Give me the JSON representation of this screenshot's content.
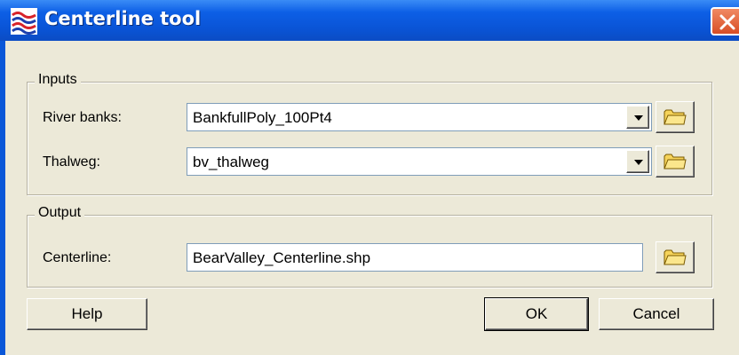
{
  "window": {
    "title": "Centerline tool"
  },
  "inputs": {
    "legend": "Inputs",
    "river_banks": {
      "label": "River banks:",
      "value": "BankfullPoly_100Pt4"
    },
    "thalweg": {
      "label": "Thalweg:",
      "value": "bv_thalweg"
    }
  },
  "output": {
    "legend": "Output",
    "centerline": {
      "label": "Centerline:",
      "value": "BearValley_Centerline.shp"
    }
  },
  "buttons": {
    "help": "Help",
    "ok": "OK",
    "cancel": "Cancel"
  },
  "icons": {
    "title": "centerline-app-icon",
    "close": "close-icon",
    "browse": "folder-icon",
    "dropdown": "chevron-down-icon"
  },
  "colors": {
    "titlebar": "#0a54d6",
    "dialog_bg": "#ece9d8",
    "close_button": "#d84d25",
    "folder": "#f5d35a"
  }
}
